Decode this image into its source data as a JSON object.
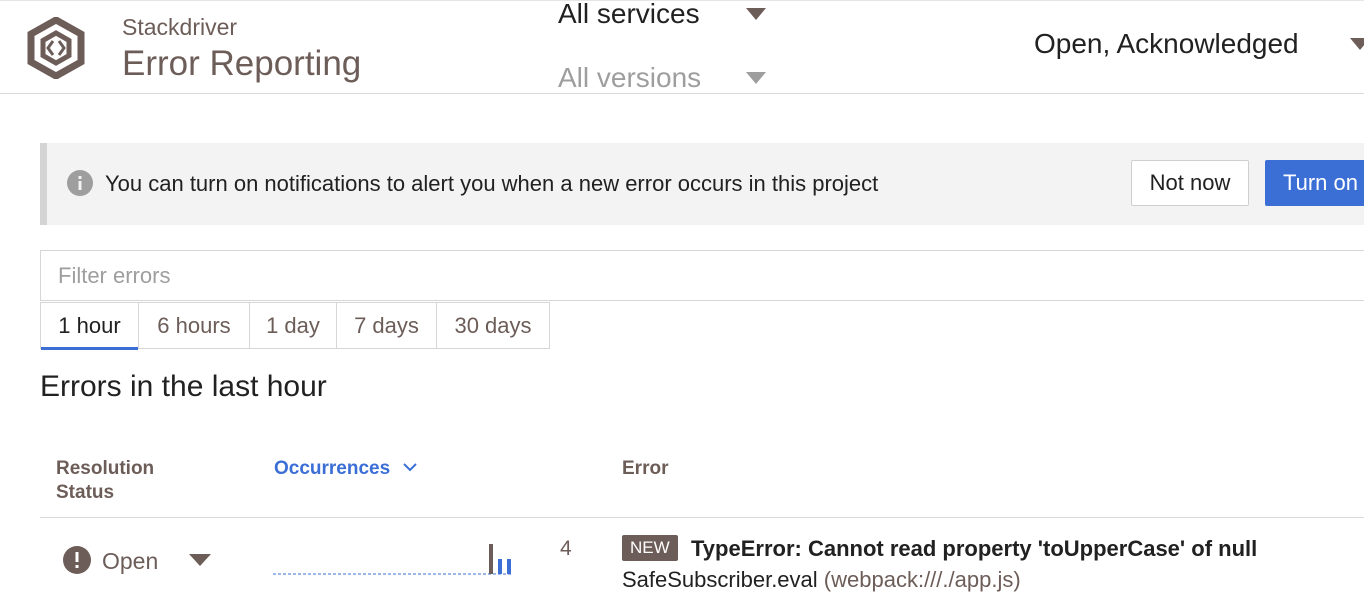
{
  "header": {
    "brand_sub": "Stackdriver",
    "brand_title": "Error Reporting",
    "service_filter": "All services",
    "version_filter": "All versions",
    "status_filter": "Open, Acknowledged"
  },
  "notification_banner": {
    "message": "You can turn on notifications to alert you when a new error occurs in this project",
    "dismiss_label": "Not now",
    "enable_label": "Turn on"
  },
  "filter": {
    "placeholder": "Filter errors"
  },
  "time_tabs": [
    {
      "label": "1 hour",
      "active": true
    },
    {
      "label": "6 hours"
    },
    {
      "label": "1 day"
    },
    {
      "label": "7 days"
    },
    {
      "label": "30 days"
    }
  ],
  "section_title": "Errors in the last hour",
  "table": {
    "columns": {
      "resolution": "Resolution Status",
      "occurrences": "Occurrences",
      "error": "Error"
    },
    "rows": [
      {
        "status": "Open",
        "occurrences": "4",
        "badge": "NEW",
        "title": "TypeError: Cannot read property 'toUpperCase' of null",
        "function": "SafeSubscriber.eval",
        "file": "(webpack:///./app.js)",
        "sparkline": [
          0,
          0,
          0,
          0,
          0,
          0,
          0,
          0,
          0,
          0,
          0,
          0,
          0,
          0,
          0,
          0,
          0,
          0,
          0,
          0,
          0,
          0,
          0,
          0,
          0,
          0,
          0,
          0,
          0,
          0,
          0,
          0,
          0,
          0,
          0,
          0,
          0,
          0,
          0,
          0,
          0,
          0,
          0,
          0,
          0,
          0,
          0,
          0,
          0,
          0,
          0,
          0,
          0,
          0,
          0,
          0,
          0,
          0,
          0,
          0,
          0,
          0,
          0,
          0,
          0,
          0,
          0,
          0,
          0,
          0,
          0,
          0,
          0,
          0,
          0,
          0,
          0,
          0,
          0,
          0,
          0,
          0,
          0,
          0,
          0,
          0,
          0,
          0,
          0,
          0,
          0,
          0,
          0,
          0,
          0,
          0,
          0,
          0,
          0,
          0,
          0,
          0,
          0,
          0,
          0,
          0,
          0,
          0,
          0,
          0,
          0,
          0,
          0,
          0,
          0,
          0,
          0,
          0,
          0,
          0,
          0,
          0,
          0,
          0,
          0,
          0,
          0,
          0,
          0,
          0,
          0,
          0,
          0,
          0,
          0,
          0,
          0,
          0,
          0,
          0,
          0,
          0,
          0,
          0,
          0,
          0,
          0,
          0,
          0,
          0,
          0,
          0,
          0,
          0,
          0,
          0,
          0,
          0,
          0,
          0,
          0,
          0,
          0,
          0,
          0,
          0,
          0,
          0,
          0,
          0,
          0,
          0,
          0,
          0,
          0,
          0,
          0,
          0,
          0,
          0,
          0,
          0,
          0,
          0,
          0,
          0,
          0,
          0,
          0,
          0,
          0,
          0,
          0,
          0,
          0,
          0,
          0,
          0,
          0,
          0,
          0,
          0,
          0,
          0,
          0,
          0,
          0,
          0,
          0,
          0,
          0,
          0,
          0,
          0,
          0,
          0,
          2,
          0,
          0,
          0,
          0,
          0,
          0,
          0,
          0,
          1,
          0,
          0,
          0,
          0,
          0,
          0,
          0,
          0,
          1,
          0,
          0,
          0,
          0,
          0
        ]
      }
    ]
  },
  "colors": {
    "brand": "#6d5d58",
    "accent": "#3b6fd6",
    "bar_primary": "#3b6fd6",
    "bar_muted": "#6d5d58"
  }
}
